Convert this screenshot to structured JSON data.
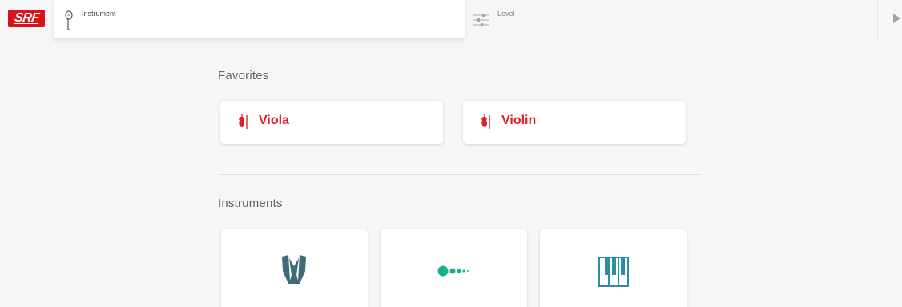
{
  "app": {
    "logo_text": "SRF",
    "brand_color": "#d8121b"
  },
  "search": {
    "instrument_label": "Instrument",
    "level_label": "Level"
  },
  "favorites": {
    "title": "Favorites",
    "items": [
      {
        "label": "Viola",
        "icon": "violin-icon"
      },
      {
        "label": "Violin",
        "icon": "violin-icon"
      }
    ],
    "accent": "#e01f2b"
  },
  "instruments": {
    "title": "Instruments",
    "items": [
      {
        "icon": "tuxedo-icon",
        "color": "#3f6b78"
      },
      {
        "icon": "dots-icon",
        "color": "#15b08e"
      },
      {
        "icon": "piano-keys-icon",
        "color": "#2a8ea8"
      }
    ]
  }
}
